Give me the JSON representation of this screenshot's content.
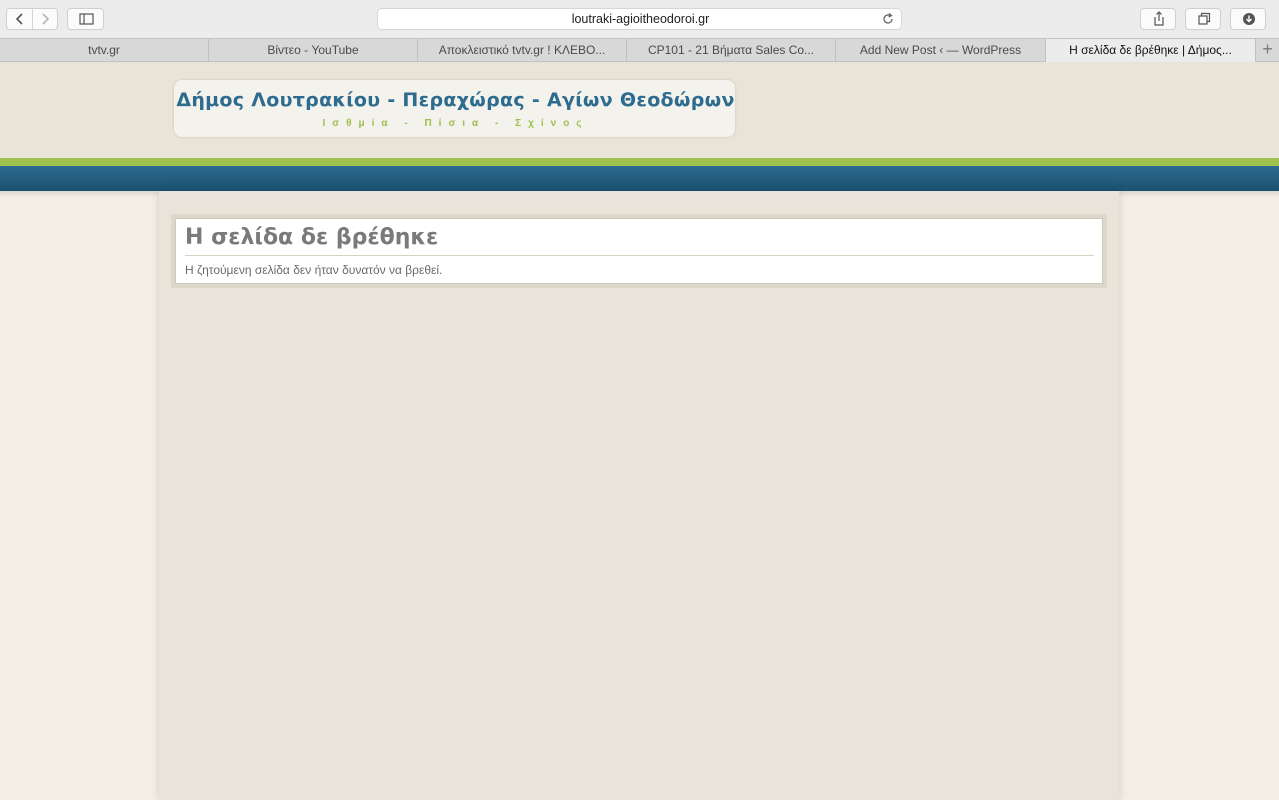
{
  "browser": {
    "address": "loutraki-agioitheodoroi.gr",
    "tabs": [
      {
        "label": "tvtv.gr",
        "active": false
      },
      {
        "label": "Βίντεο - YouTube",
        "active": false
      },
      {
        "label": "Αποκλειστικό tvtv.gr ! ΚΛΕΒΟ...",
        "active": false
      },
      {
        "label": "CP101 - 21 Βήματα Sales Co...",
        "active": false
      },
      {
        "label": "Add New Post ‹ — WordPress",
        "active": false
      },
      {
        "label": "Η σελίδα δε βρέθηκε | Δήμος...",
        "active": true
      }
    ],
    "new_tab": "+",
    "icons": {
      "back": "chevron-left-icon",
      "forward": "chevron-right-icon",
      "sidebar": "sidebar-icon",
      "reload": "reload-icon",
      "share": "share-icon",
      "tabs": "tabs-overview-icon",
      "download": "download-icon"
    }
  },
  "site": {
    "title": "Δήμος Λουτρακίου - Περαχώρας - Αγίων Θεοδώρων",
    "subtitle": "Ισθμία - Πίσια - Σχίνος"
  },
  "post": {
    "title": "Η σελίδα δε βρέθηκε",
    "body": "Η ζητούμενη σελίδα δεν ήταν δυνατόν να βρεθεί."
  },
  "colors": {
    "title_blue": "#2d6b8f",
    "accent_green": "#9ec24d",
    "nav_blue": "#1b5170",
    "page_bg": "#f2eee3"
  }
}
